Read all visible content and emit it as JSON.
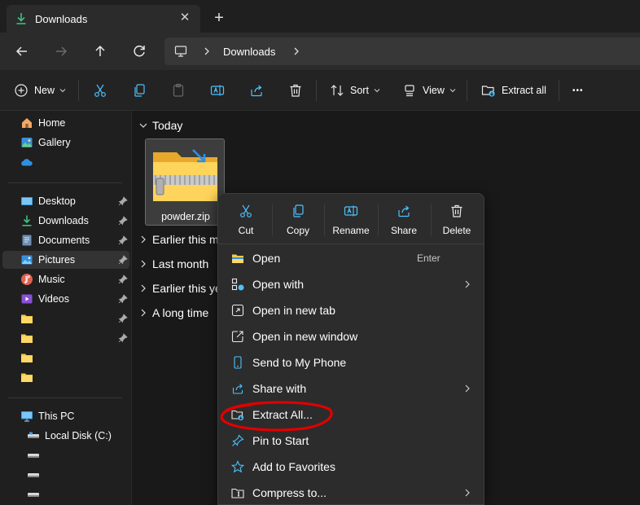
{
  "window": {
    "tab_title": "Downloads",
    "tab_close_glyph": "✕",
    "new_tab_glyph": "+"
  },
  "address_bar": {
    "location_icon": "this-pc-icon",
    "path": [
      "Downloads"
    ]
  },
  "nav_buttons": [
    "back-arrow-icon",
    "forward-arrow-icon",
    "up-arrow-icon",
    "refresh-icon"
  ],
  "command_bar": {
    "new_label": "New",
    "sort_label": "Sort",
    "view_label": "View",
    "extract_all_label": "Extract all",
    "more_glyph": "•••",
    "icons": [
      "cut-icon",
      "copy-icon",
      "paste-icon",
      "rename-icon",
      "share-icon",
      "delete-icon"
    ]
  },
  "sidebar": {
    "items": [
      {
        "label": "Home",
        "icon": "home-icon"
      },
      {
        "label": "Gallery",
        "icon": "gallery-icon"
      },
      {
        "label": "",
        "icon": "onedrive-cloud-icon"
      },
      {
        "label": "Desktop",
        "icon": "desktop-icon",
        "pinned": true
      },
      {
        "label": "Downloads",
        "icon": "download-icon",
        "pinned": true
      },
      {
        "label": "Documents",
        "icon": "documents-icon",
        "pinned": true
      },
      {
        "label": "Pictures",
        "icon": "pictures-icon",
        "pinned": true,
        "selected": true
      },
      {
        "label": "Music",
        "icon": "music-icon",
        "pinned": true
      },
      {
        "label": "Videos",
        "icon": "videos-icon",
        "pinned": true
      },
      {
        "label": "",
        "icon": "folder-icon",
        "pinned": true
      },
      {
        "label": "",
        "icon": "folder-icon",
        "pinned": true
      },
      {
        "label": "",
        "icon": "folder-icon"
      },
      {
        "label": "",
        "icon": "folder-icon"
      },
      {
        "label": "This PC",
        "icon": "this-pc-icon"
      },
      {
        "label": "Local Disk (C:)",
        "icon": "drive-icon"
      },
      {
        "label": "",
        "icon": "drive-icon"
      },
      {
        "label": "",
        "icon": "drive-icon"
      },
      {
        "label": "",
        "icon": "drive-icon"
      }
    ]
  },
  "content": {
    "groups": [
      {
        "label": "Today",
        "expanded": true
      },
      {
        "label": "Earlier this m",
        "expanded": false
      },
      {
        "label": "Last month",
        "expanded": false
      },
      {
        "label": "Earlier this ye",
        "expanded": false
      },
      {
        "label": "A long time",
        "expanded": false
      }
    ],
    "files": [
      {
        "name": "powder.zip",
        "icon": "zip-folder-icon",
        "selected": true
      }
    ]
  },
  "context_menu": {
    "actions": [
      {
        "label": "Cut",
        "icon": "cut-icon"
      },
      {
        "label": "Copy",
        "icon": "copy-icon"
      },
      {
        "label": "Rename",
        "icon": "rename-icon"
      },
      {
        "label": "Share",
        "icon": "share-icon"
      },
      {
        "label": "Delete",
        "icon": "delete-icon"
      }
    ],
    "items": [
      {
        "label": "Open",
        "icon": "open-folder-icon",
        "shortcut": "Enter",
        "submenu": false
      },
      {
        "label": "Open with",
        "icon": "open-with-icon",
        "submenu": true
      },
      {
        "label": "Open in new tab",
        "icon": "new-tab-icon",
        "submenu": false
      },
      {
        "label": "Open in new window",
        "icon": "new-window-icon",
        "submenu": false
      },
      {
        "label": "Send to My Phone",
        "icon": "phone-icon",
        "submenu": false
      },
      {
        "label": "Share with",
        "icon": "share-with-icon",
        "submenu": true
      },
      {
        "label": "Extract All...",
        "icon": "extract-icon",
        "submenu": false,
        "annotated": true
      },
      {
        "label": "Pin to Start",
        "icon": "pin-icon",
        "submenu": false
      },
      {
        "label": "Add to Favorites",
        "icon": "star-icon",
        "submenu": false
      },
      {
        "label": "Compress to...",
        "icon": "compress-icon",
        "submenu": true
      }
    ]
  },
  "colors": {
    "accent": "#4cc2ff",
    "download_green": "#3fbf7f",
    "folder_yellow": "#f7c948",
    "annotation_red": "#e00000"
  }
}
